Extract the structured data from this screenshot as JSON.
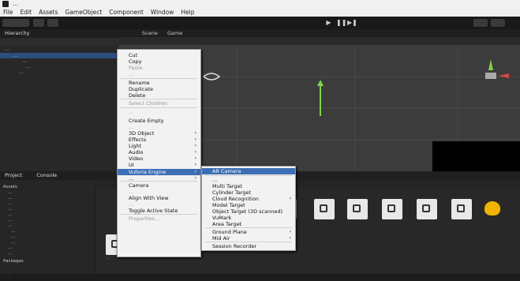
{
  "titlebar": {
    "title": "…"
  },
  "menubar": [
    "File",
    "Edit",
    "Assets",
    "GameObject",
    "Component",
    "Window",
    "Help"
  ],
  "hierarchy": {
    "tab": "Hierarchy",
    "rows": [
      "…",
      "…",
      "…",
      "…",
      "…"
    ]
  },
  "scene": {
    "tabs": [
      "Scene",
      "Game"
    ]
  },
  "context_menu": {
    "items": [
      {
        "label": "Cut",
        "dim": false
      },
      {
        "label": "Copy",
        "dim": false
      },
      {
        "label": "Paste",
        "dim": true
      },
      {
        "label": "…",
        "dim": true
      },
      {
        "label": "Rename",
        "dim": false
      },
      {
        "label": "Duplicate",
        "dim": false
      },
      {
        "label": "Delete",
        "dim": false
      },
      {
        "label": "Select Children",
        "dim": true
      },
      {
        "label": "…",
        "dim": true
      },
      {
        "label": "Create Empty",
        "dim": false
      },
      {
        "label": "…",
        "dim": true
      },
      {
        "label": "3D Object",
        "dim": false,
        "sub": true
      },
      {
        "label": "Effects",
        "dim": false,
        "sub": true
      },
      {
        "label": "Light",
        "dim": false,
        "sub": true
      },
      {
        "label": "Audio",
        "dim": false,
        "sub": true
      },
      {
        "label": "Video",
        "dim": false,
        "sub": true
      },
      {
        "label": "UI",
        "dim": false,
        "sub": true
      },
      {
        "label": "Vuforia Engine",
        "dim": false,
        "sub": true,
        "selected": true
      },
      {
        "label": "…",
        "dim": false,
        "sub": true
      },
      {
        "label": "Camera",
        "dim": false
      },
      {
        "label": "…",
        "dim": true
      },
      {
        "label": "Align With View",
        "dim": false
      },
      {
        "label": "…",
        "dim": true
      },
      {
        "label": "Toggle Active State",
        "dim": false
      },
      {
        "label": "Properties...",
        "dim": true
      }
    ]
  },
  "submenu": {
    "items": [
      {
        "label": "AR Camera",
        "selected": true
      },
      {
        "label": "…"
      },
      {
        "label": "Multi Target"
      },
      {
        "label": "Cylinder Target"
      },
      {
        "label": "Cloud Recognition",
        "sub": true
      },
      {
        "label": "Model Target"
      },
      {
        "label": "Object Target (3D scanned)"
      },
      {
        "label": "VuMark"
      },
      {
        "label": "Area Target"
      },
      {
        "label": "Ground Plane",
        "sub": true
      },
      {
        "label": "Mid Air",
        "sub": true
      },
      {
        "label": "Session Recorder"
      }
    ]
  },
  "project": {
    "tabs": [
      "Project",
      "Console"
    ],
    "tree": [
      "Assets",
      "…",
      "…",
      "…",
      "…",
      "…",
      "…",
      "…",
      "…",
      "…",
      "…",
      "…",
      "…",
      "Packages"
    ],
    "assets_label": "…"
  },
  "status": {
    "text": "…"
  }
}
